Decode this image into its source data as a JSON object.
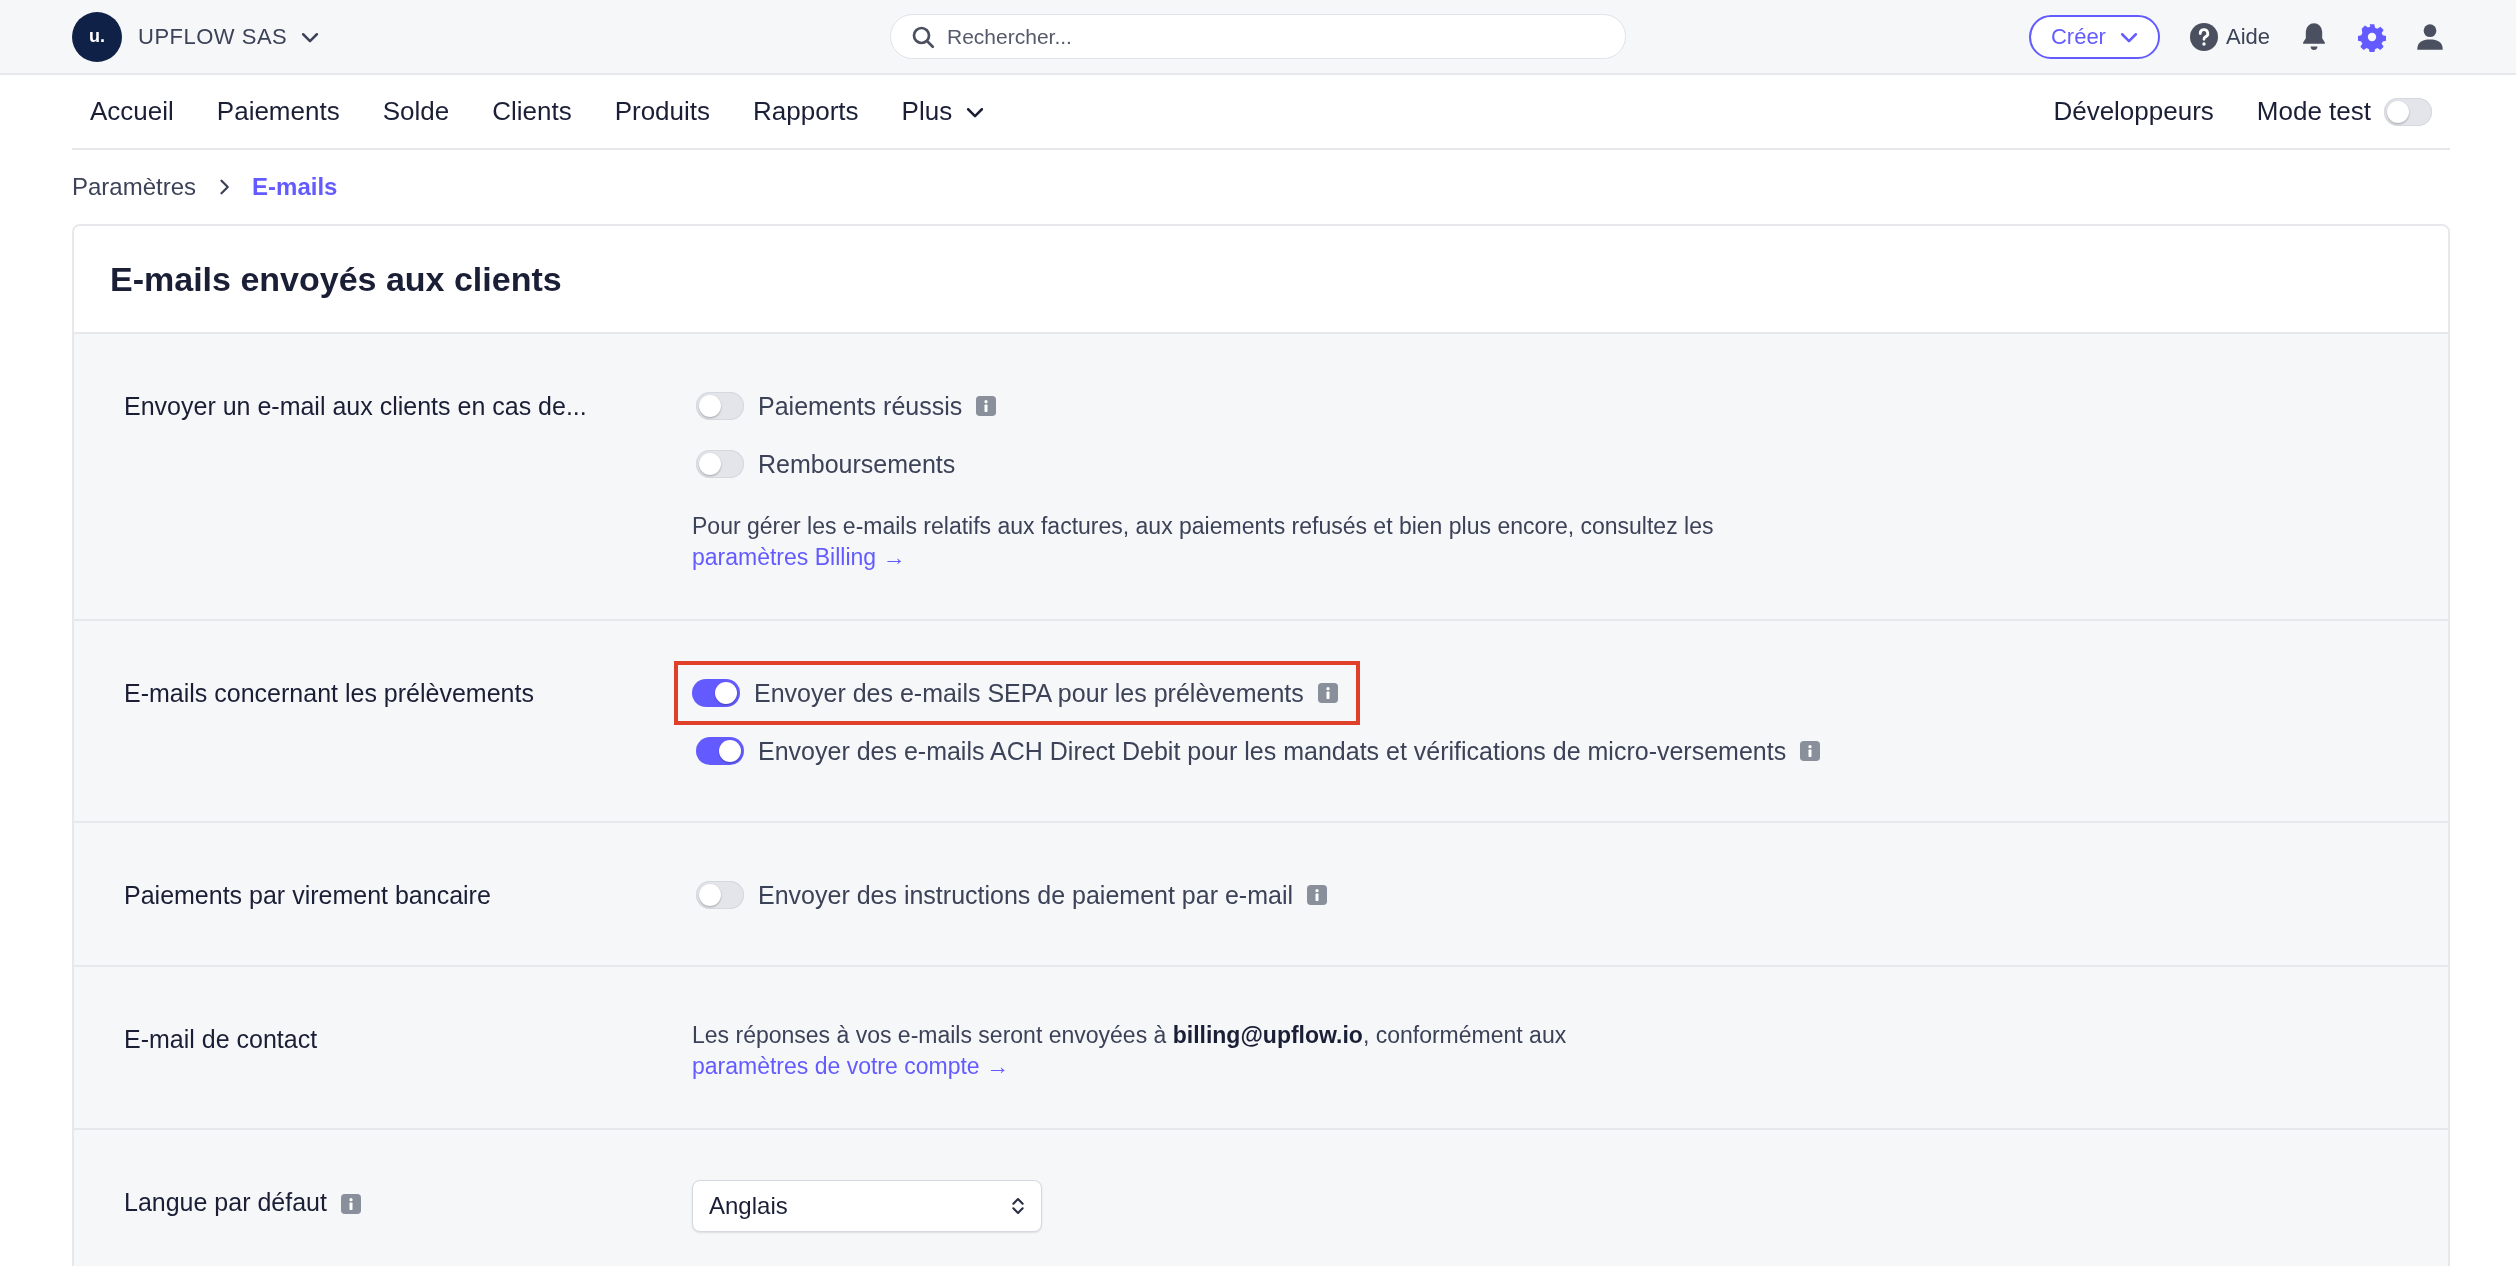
{
  "account": {
    "initial": "u.",
    "name": "UPFLOW SAS"
  },
  "search": {
    "placeholder": "Rechercher..."
  },
  "header_actions": {
    "create": "Créer",
    "help": "Aide"
  },
  "nav": {
    "items": [
      "Accueil",
      "Paiements",
      "Solde",
      "Clients",
      "Produits",
      "Rapports"
    ],
    "more": "Plus",
    "developers": "Développeurs",
    "test_mode": {
      "label": "Mode test",
      "on": false
    }
  },
  "breadcrumb": [
    {
      "label": "Paramètres",
      "selected": false
    },
    {
      "label": "E-mails",
      "selected": true
    }
  ],
  "card": {
    "title": "E-mails envoyés aux clients",
    "sections": [
      {
        "kind": "toggles",
        "label": "Envoyer un e-mail aux clients en cas de...",
        "options": [
          {
            "label": "Paiements réussis",
            "on": false,
            "info": true,
            "highlighted": false
          },
          {
            "label": "Remboursements",
            "on": false,
            "info": false,
            "highlighted": false
          }
        ],
        "note": "Pour gérer les e-mails relatifs aux factures, aux paiements refusés et bien plus encore, consultez les",
        "link": "paramètres Billing →"
      },
      {
        "kind": "toggles",
        "label": "E-mails concernant les prélèvements",
        "options": [
          {
            "label": "Envoyer des e-mails SEPA pour les prélèvements",
            "on": true,
            "info": true,
            "highlighted": true
          },
          {
            "label": "Envoyer des e-mails ACH Direct Debit pour les mandats et vérifications de micro-versements",
            "on": true,
            "info": true,
            "highlighted": false
          }
        ]
      },
      {
        "kind": "toggles",
        "label": "Paiements par virement bancaire",
        "options": [
          {
            "label": "Envoyer des instructions de paiement par e-mail",
            "on": false,
            "info": true,
            "highlighted": false
          }
        ]
      },
      {
        "kind": "text",
        "label": "E-mail de contact",
        "note": "Les réponses à vos e-mails seront envoyées à **billing@upflow.io**, conformément aux",
        "link": "paramètres de votre compte →"
      },
      {
        "kind": "select",
        "label": "Langue par défaut",
        "label_info": true,
        "value": "Anglais"
      }
    ]
  }
}
